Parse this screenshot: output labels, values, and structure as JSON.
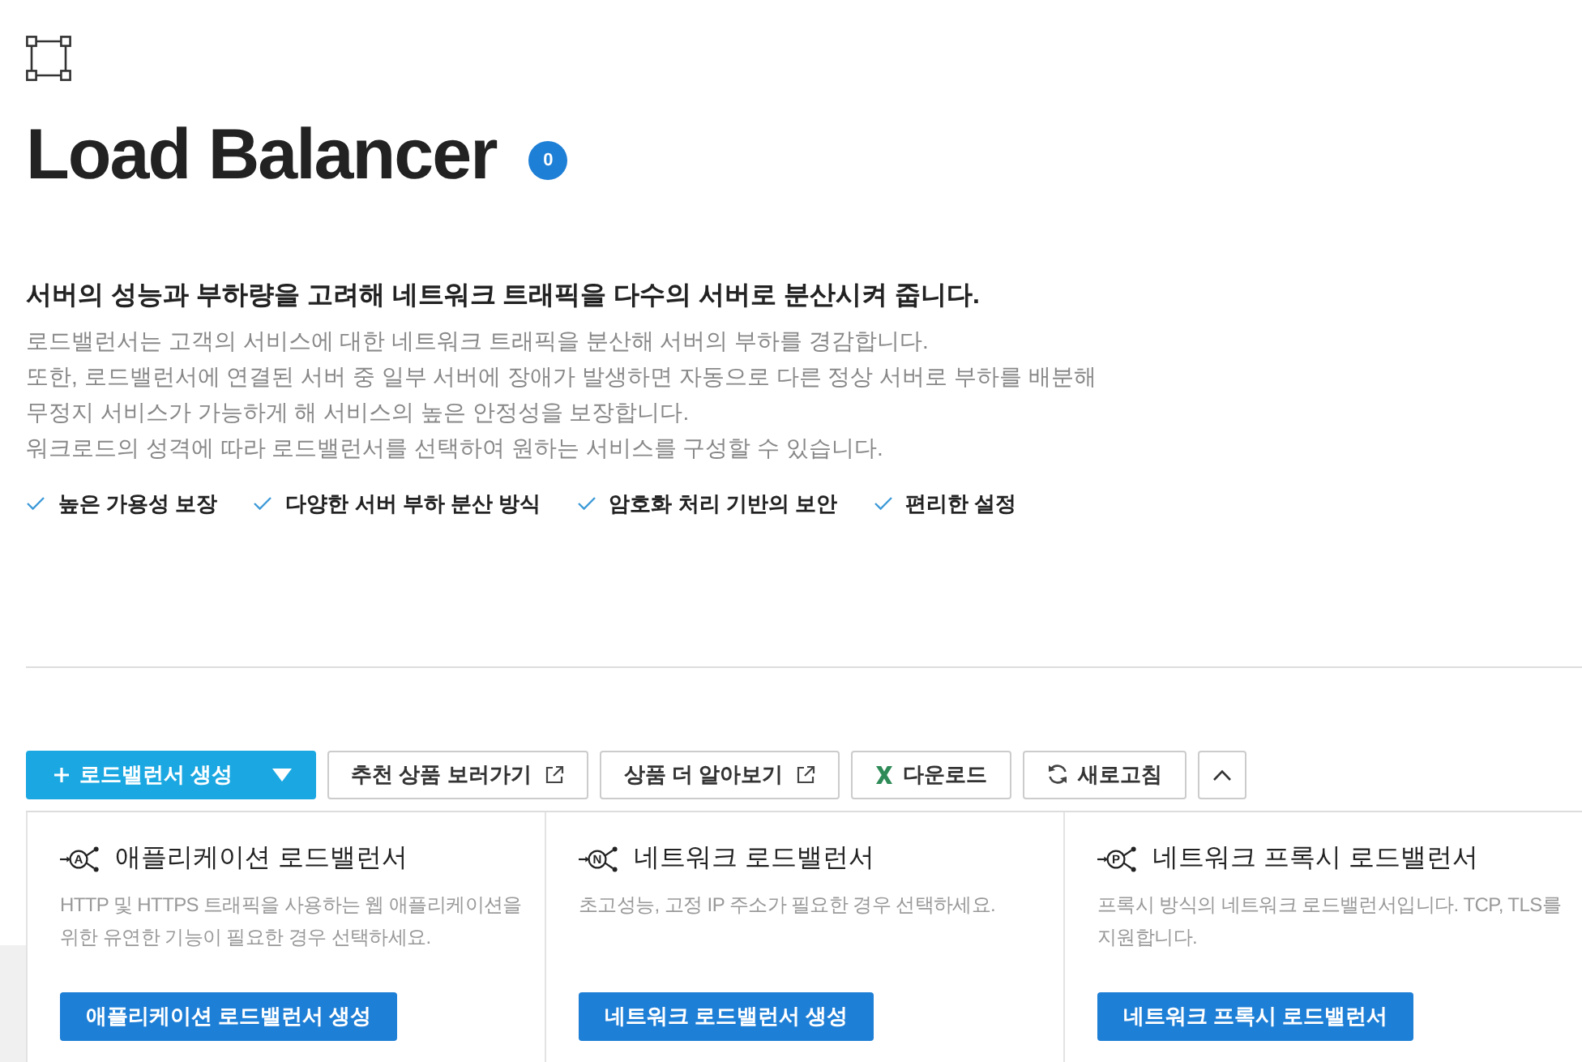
{
  "header": {
    "title": "Load Balancer",
    "count": "0"
  },
  "intro": {
    "heading": "서버의 성능과 부하량을 고려해 네트워크 트래픽을 다수의 서버로 분산시켜 줍니다.",
    "lines": [
      "로드밸런서는 고객의 서비스에 대한 네트워크 트래픽을 분산해 서버의 부하를 경감합니다.",
      "또한, 로드밸런서에 연결된 서버 중 일부 서버에 장애가 발생하면 자동으로 다른 정상 서버로 부하를 배분해",
      "무정지 서비스가 가능하게 해 서비스의 높은 안정성을 보장합니다.",
      "워크로드의 성격에 따라 로드밸런서를 선택하여 원하는 서비스를 구성할 수 있습니다."
    ]
  },
  "features": [
    "높은 가용성 보장",
    "다양한 서버 부하 분산 방식",
    "암호화 처리 기반의 보안",
    "편리한 설정"
  ],
  "toolbar": [
    {
      "kind": "create",
      "label": "로드밸런서 생성"
    },
    {
      "kind": "external",
      "label": "추천 상품 보러가기"
    },
    {
      "kind": "external",
      "label": "상품 더 알아보기"
    },
    {
      "kind": "download",
      "label": "다운로드"
    },
    {
      "kind": "refresh",
      "label": "새로고침"
    },
    {
      "kind": "collapse",
      "expanded": true
    }
  ],
  "cards": [
    {
      "icon_letter": "A",
      "title": "애플리케이션 로드밸런서",
      "description": "HTTP 및 HTTPS 트래픽을 사용하는 웹 애플리케이션을 위한 유연한 기능이 필요한 경우 선택하세요.",
      "button": "애플리케이션 로드밸런서 생성"
    },
    {
      "icon_letter": "N",
      "title": "네트워크 로드밸런서",
      "description": "초고성능, 고정 IP 주소가 필요한 경우 선택하세요.",
      "button": "네트워크 로드밸런서 생성"
    },
    {
      "icon_letter": "P",
      "title": "네트워크 프록시 로드밸런서",
      "description": "프록시 방식의 네트워크 로드밸런서입니다. TCP, TLS를 지원합니다.",
      "button": "네트워크 프록시 로드밸런서"
    }
  ]
}
